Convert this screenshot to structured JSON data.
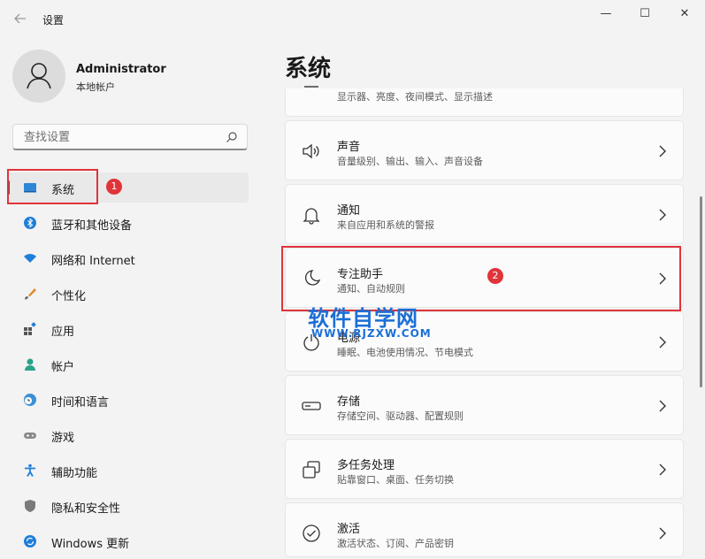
{
  "window": {
    "title": "设置",
    "controls": [
      "—",
      "☐",
      "✕"
    ]
  },
  "user": {
    "name": "Administrator",
    "account_type": "本地帐户"
  },
  "search": {
    "value": "",
    "placeholder": "查找设置"
  },
  "sidebar": {
    "items": [
      {
        "label": "系统",
        "icon": "system-icon",
        "active": true
      },
      {
        "label": "蓝牙和其他设备",
        "icon": "bluetooth-icon"
      },
      {
        "label": "网络和 Internet",
        "icon": "wifi-icon"
      },
      {
        "label": "个性化",
        "icon": "brush-icon"
      },
      {
        "label": "应用",
        "icon": "apps-icon"
      },
      {
        "label": "帐户",
        "icon": "account-icon"
      },
      {
        "label": "时间和语言",
        "icon": "clock-globe-icon"
      },
      {
        "label": "游戏",
        "icon": "gamepad-icon"
      },
      {
        "label": "辅助功能",
        "icon": "accessibility-icon"
      },
      {
        "label": "隐私和安全性",
        "icon": "shield-icon"
      },
      {
        "label": "Windows 更新",
        "icon": "update-icon"
      }
    ]
  },
  "annotations": {
    "badge1": "1",
    "badge2": "2"
  },
  "main": {
    "heading": "系统",
    "cards": [
      {
        "title": "",
        "subtitle": "显示器、亮度、夜间模式、显示描述",
        "icon": "display-icon"
      },
      {
        "title": "声音",
        "subtitle": "音量级别、输出、输入、声音设备",
        "icon": "speaker-icon"
      },
      {
        "title": "通知",
        "subtitle": "来自应用和系统的警报",
        "icon": "bell-icon"
      },
      {
        "title": "专注助手",
        "subtitle": "通知、自动规则",
        "icon": "moon-icon"
      },
      {
        "title": "电源",
        "subtitle": "睡眠、电池使用情况、节电模式",
        "icon": "power-icon"
      },
      {
        "title": "存储",
        "subtitle": "存储空间、驱动器、配置规则",
        "icon": "storage-icon"
      },
      {
        "title": "多任务处理",
        "subtitle": "贴靠窗口、桌面、任务切换",
        "icon": "multitask-icon"
      },
      {
        "title": "激活",
        "subtitle": "激活状态、订阅、产品密钥",
        "icon": "check-circle-icon"
      }
    ]
  },
  "watermark": {
    "text": "软件自学网",
    "url": "WWW.RJZXW.COM"
  },
  "colors": {
    "accent": "#0067c0",
    "annotation_red": "#e0343a",
    "watermark_blue": "#1a6fd6"
  }
}
